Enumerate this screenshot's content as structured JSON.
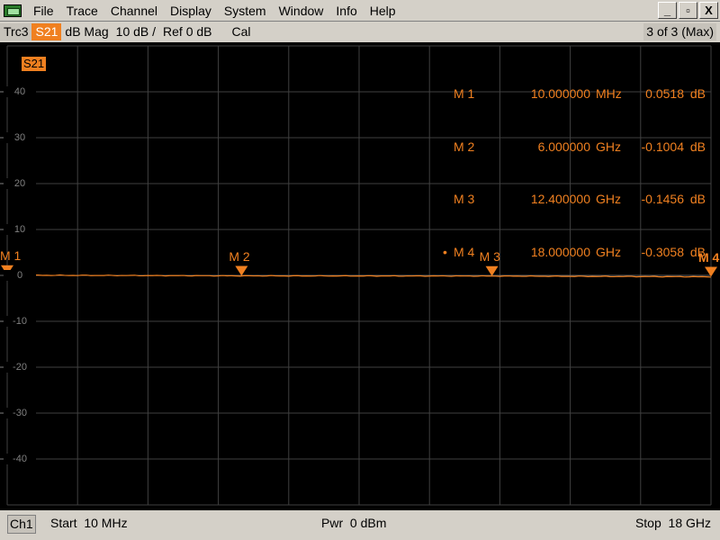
{
  "menubar": {
    "items": [
      "File",
      "Trace",
      "Channel",
      "Display",
      "System",
      "Window",
      "Info",
      "Help"
    ],
    "window_buttons": [
      "_",
      "▫",
      "X"
    ]
  },
  "tracebar": {
    "trace": "Trc3",
    "param": "S21",
    "format": "dB Mag",
    "scale": "10 dB /",
    "ref": "Ref 0 dB",
    "cal": "Cal",
    "count": "3 of 3 (Max)"
  },
  "plot": {
    "param_tag": "S21",
    "y_labels": [
      "40",
      "30",
      "20",
      "10",
      "0",
      "-10",
      "-20",
      "-30",
      "-40"
    ],
    "y_ticks": [
      40,
      30,
      20,
      10,
      0,
      -10,
      -20,
      -30,
      -40
    ],
    "grid_color": "#404040",
    "trace_color": "#f08020"
  },
  "chart_data": {
    "type": "line",
    "x_range_ghz": [
      0.01,
      18
    ],
    "ylim": [
      -50,
      50
    ],
    "y_scale_per_div": 10,
    "ylabel": "",
    "xlabel": "",
    "series": [
      {
        "name": "S21",
        "x_ghz": [
          0.01,
          6.0,
          12.4,
          18.0
        ],
        "values": [
          0.0518,
          -0.1004,
          -0.1456,
          -0.3058
        ]
      }
    ]
  },
  "markers": [
    {
      "name": "M 1",
      "label": "M 1",
      "freq": "10.000000",
      "unit": "MHz",
      "value": "0.0518",
      "db": "dB",
      "active": "",
      "x_ghz": 0.01,
      "y_db": 0.0518
    },
    {
      "name": "M 2",
      "label": "M 2",
      "freq": "6.000000",
      "unit": "GHz",
      "value": "-0.1004",
      "db": "dB",
      "active": "",
      "x_ghz": 6.0,
      "y_db": -0.1004
    },
    {
      "name": "M 3",
      "label": "M 3",
      "freq": "12.400000",
      "unit": "GHz",
      "value": "-0.1456",
      "db": "dB",
      "active": "",
      "x_ghz": 12.4,
      "y_db": -0.1456
    },
    {
      "name": "M 4",
      "label": "M 4",
      "freq": "18.000000",
      "unit": "GHz",
      "value": "-0.3058",
      "db": "dB",
      "active": "•",
      "x_ghz": 18.0,
      "y_db": -0.3058
    }
  ],
  "statusbar": {
    "channel": "Ch1",
    "start": "Start  10 MHz",
    "power": "Pwr  0 dBm",
    "stop": "Stop  18 GHz"
  }
}
